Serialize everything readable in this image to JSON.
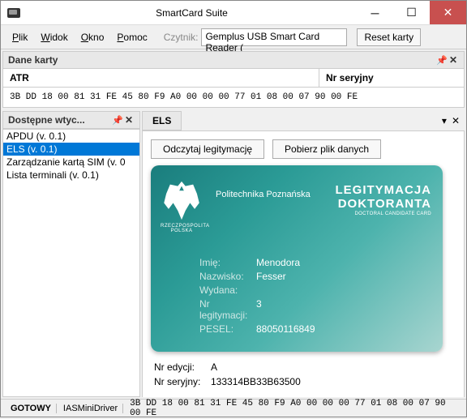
{
  "window": {
    "title": "SmartCard Suite"
  },
  "menu": {
    "plik": "Plik",
    "widok": "Widok",
    "okno": "Okno",
    "pomoc": "Pomoc",
    "czytnik_label": "Czytnik:",
    "reader_selected": "Gemplus USB Smart Card Reader (",
    "reset": "Reset karty"
  },
  "dane": {
    "title": "Dane karty",
    "atr_label": "ATR",
    "nr_label": "Nr seryjny",
    "atr_value": "3B DD 18 00 81 31 FE 45 80 F9 A0 00 00 00 77 01 08 00 07 90 00 FE"
  },
  "sidebar": {
    "title": "Dostępne wtyc...",
    "items": [
      "APDU (v. 0.1)",
      "ELS (v. 0.1)",
      "Zarządzanie kartą SIM (v. 0",
      "Lista terminali (v. 0.1)"
    ]
  },
  "tab": {
    "label": "ELS"
  },
  "buttons": {
    "read": "Odczytaj legitymację",
    "download": "Pobierz plik danych"
  },
  "card": {
    "emblem_label": "RZECZPOSPOLITA POLSKA",
    "university": "Politechnika Poznańska",
    "legit1": "LEGITYMACJA",
    "legit2": "DOKTORANTA",
    "legit3": "DOCTORAL CANDIDATE CARD",
    "fields": {
      "imie_label": "Imię:",
      "imie": "Menodora",
      "nazwisko_label": "Nazwisko:",
      "nazwisko": "Fesser",
      "wydana_label": "Wydana:",
      "wydana": "",
      "nrleg_label": "Nr legitymacji:",
      "nrleg": "3",
      "pesel_label": "PESEL:",
      "pesel": "88050116849"
    }
  },
  "bottom": {
    "edycji_label": "Nr edycji:",
    "edycji": "A",
    "seryjny_label": "Nr seryjny:",
    "seryjny": "133314BB33B63500"
  },
  "status": {
    "state": "GOTOWY",
    "driver": "IASMiniDriver",
    "atr": "3B DD 18 00 81 31 FE 45 80 F9 A0 00 00 00 77 01 08 00 07 90 00 FE"
  }
}
